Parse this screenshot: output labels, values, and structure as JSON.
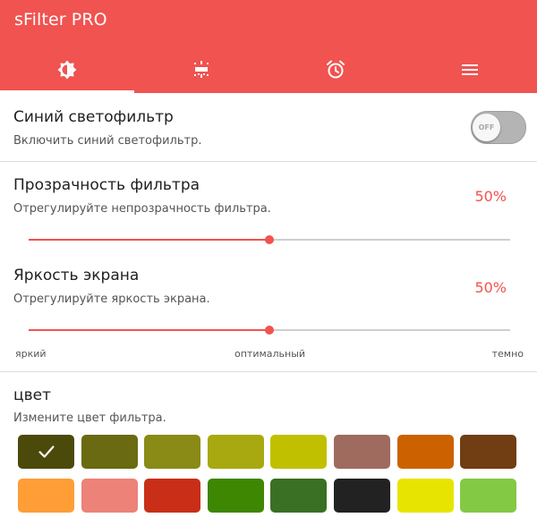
{
  "app": {
    "title": "sFilter PRO"
  },
  "tabs": [
    {
      "icon": "brightness-contrast-icon",
      "active": true
    },
    {
      "icon": "sun-filter-icon",
      "active": false
    },
    {
      "icon": "alarm-clock-icon",
      "active": false
    },
    {
      "icon": "menu-icon",
      "active": false
    }
  ],
  "blue_filter": {
    "title": "Синий светофильтр",
    "subtitle": "Включить синий светофильтр.",
    "toggle_label": "OFF",
    "enabled": false
  },
  "opacity": {
    "title": "Прозрачность фильтра",
    "subtitle": "Отрегулируйте непрозрачность фильтра.",
    "value_label": "50%",
    "value": 0.5
  },
  "brightness": {
    "title": "Яркость экрана",
    "subtitle": "Отрегулируйте яркость экрана.",
    "value_label": "50%",
    "value": 0.5
  },
  "scale_labels": {
    "left": "яркий",
    "middle": "оптимальный",
    "right": "темно"
  },
  "color": {
    "title": "цвет",
    "subtitle": "Измените цвет фильтра.",
    "selected_index": 0,
    "swatches": [
      "#4b4a0a",
      "#6a6a12",
      "#8a8a16",
      "#a8a810",
      "#c0c000",
      "#9e6b5e",
      "#cc6100",
      "#713d12",
      "#ff9d36",
      "#ed8278",
      "#c92f18",
      "#3d8702",
      "#3a7023",
      "#222222",
      "#e8e401",
      "#84c943"
    ]
  },
  "colors": {
    "accent": "#f05350",
    "appbar": "#f05350"
  }
}
